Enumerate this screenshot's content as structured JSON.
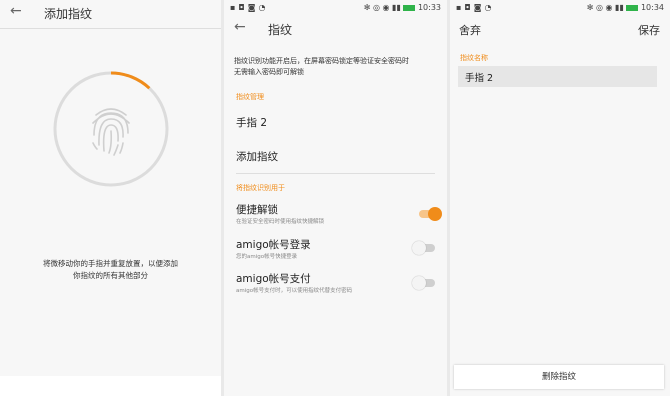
{
  "colors": {
    "accent": "#f08c1a",
    "background": "#f7f7f7"
  },
  "panel1": {
    "title": "添加指纹",
    "hint_line1": "将微移动你的手指并重复放置，以便添加",
    "hint_line2": "你指纹的所有其他部分",
    "progress": 0.12
  },
  "panel2": {
    "status_time": "10:33",
    "title": "指纹",
    "desc_line1": "指纹识别功能开启后，在屏幕密码锁定等验证安全密码时",
    "desc_line2": "无需输入密码即可解锁",
    "section_manage": "指纹管理",
    "fingerprint_item": "手指 2",
    "add_fingerprint": "添加指纹",
    "section_use": "将指纹识别用于",
    "options": [
      {
        "label": "便捷解锁",
        "sub": "在验证安全密码时使用指纹快捷解锁",
        "on": true
      },
      {
        "label": "amigo帐号登录",
        "sub": "您的amigo帐号快捷登录",
        "on": false
      },
      {
        "label": "amigo帐号支付",
        "sub": "amigo帐号支付时，可以使用指纹代替支付密码",
        "on": false
      }
    ]
  },
  "panel3": {
    "status_time": "10:34",
    "discard": "舍弃",
    "save": "保存",
    "name_label": "指纹名称",
    "name_value": "手指 2",
    "delete": "删除指纹"
  }
}
